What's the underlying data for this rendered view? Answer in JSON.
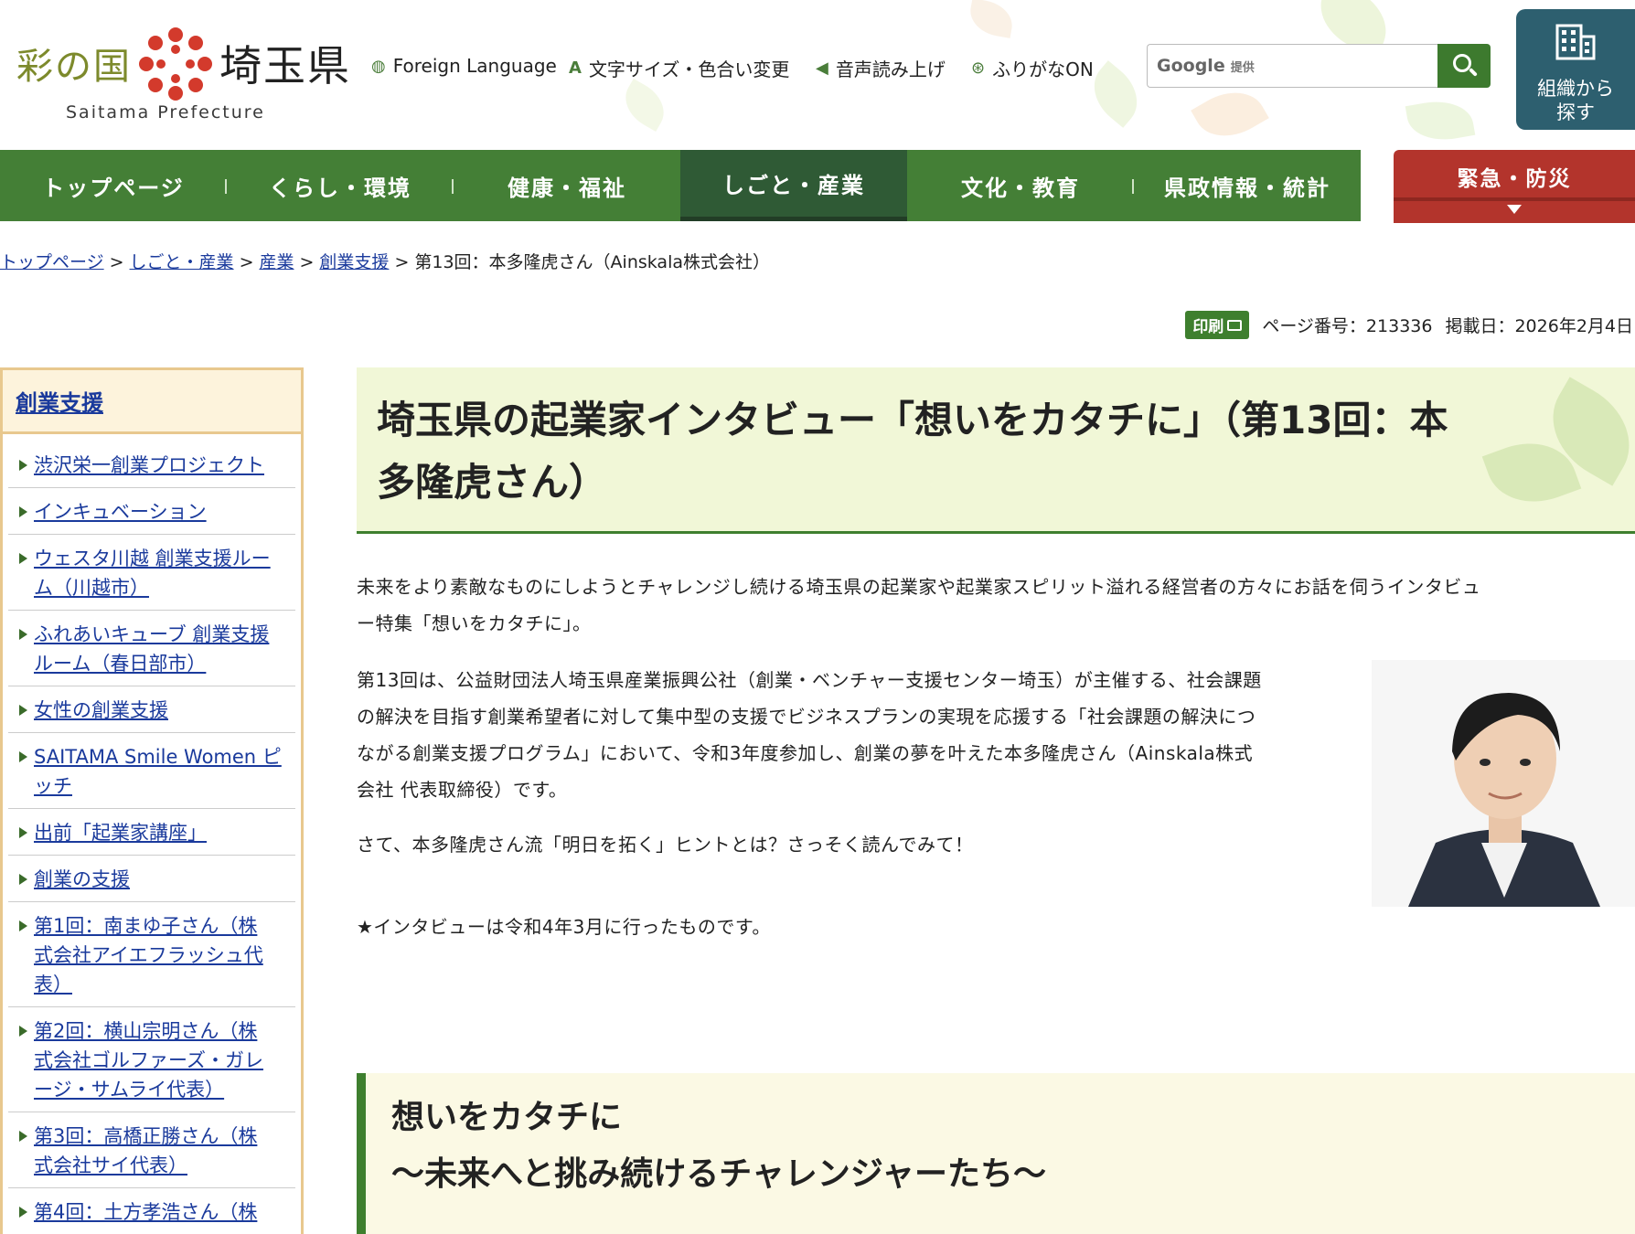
{
  "header": {
    "logo": {
      "irono": "彩の国",
      "pref": "埼玉県",
      "en": "Saitama Prefecture"
    },
    "utility_links": [
      {
        "label": "Foreign Language",
        "icon": "globe-icon"
      },
      {
        "label": "文字サイズ・色合い変更",
        "icon": "text-size-icon"
      },
      {
        "label": "音声読み上げ",
        "icon": "speaker-icon"
      },
      {
        "label": "ふりがなON",
        "icon": "furigana-icon"
      }
    ],
    "search": {
      "brand": "Google",
      "provided": "提供",
      "button_icon": "search-icon"
    },
    "org_button": {
      "line1": "組織から",
      "line2": "探す",
      "icon": "building-icon"
    }
  },
  "nav": {
    "items": [
      {
        "label": "トップページ"
      },
      {
        "label": "くらし・環境"
      },
      {
        "label": "健康・福祉"
      },
      {
        "label": "しごと・産業"
      },
      {
        "label": "文化・教育"
      },
      {
        "label": "県政情報・統計"
      }
    ],
    "active_index": 3,
    "emergency": "緊急・防災"
  },
  "breadcrumb": {
    "links": [
      "トップページ",
      "しごと・産業",
      "産業",
      "創業支援"
    ],
    "current": "第13回：本多隆虎さん（Ainskala株式会社）",
    "separator": ">"
  },
  "meta": {
    "print_label": "印刷",
    "page_number": "ページ番号：213336",
    "posted": "掲載日：2026年2月4日"
  },
  "sidebar": {
    "heading": "創業支援",
    "items": [
      [
        "渋沢栄一創業プロジェクト"
      ],
      [
        "インキュベーション"
      ],
      [
        "ウェスタ川越 創業支援ルー",
        "ム（川越市）"
      ],
      [
        "ふれあいキューブ 創業支援",
        "ルーム（春日部市）"
      ],
      [
        "女性の創業支援"
      ],
      [
        "SAITAMA Smile Women ピ",
        "ッチ"
      ],
      [
        "出前「起業家講座」"
      ],
      [
        "創業の支援"
      ],
      [
        "第1回：南まゆ子さん（株",
        "式会社アイエフラッシュ代",
        "表）"
      ],
      [
        "第2回：横山宗明さん（株",
        "式会社ゴルファーズ・ガレ",
        "ージ・サムライ代表）"
      ],
      [
        "第3回：高橋正勝さん（株",
        "式会社サイ代表）"
      ],
      [
        "第4回：土方孝浩さん（株"
      ]
    ]
  },
  "article": {
    "title_line1": "埼玉県の起業家インタビュー「想いをカタチに」（第13回：本",
    "title_line2": "多隆虎さん）",
    "intro_line1": "未来をより素敵なものにしようとチャレンジし続ける埼玉県の起業家や起業家スピリット溢れる経営者の方々にお話を伺うインタビュ",
    "intro_line2": "ー特集「想いをカタチに」。",
    "body_line1": "第13回は、公益財団法人埼玉県産業振興公社（創業・ベンチャー支援センター埼玉）が主催する、社会課題",
    "body_line2": "の解決を目指す創業希望者に対して集中型の支援でビジネスプランの実現を応援する「社会課題の解決につ",
    "body_line3": "ながる創業支援プログラム」において、令和3年度参加し、創業の夢を叶えた本多隆虎さん（Ainskala株式",
    "body_line4": "会社 代表取締役）です。",
    "lead": "さて、本多隆虎さん流「明日を拓く」ヒントとは？さっそく読んでみて！",
    "note": "★インタビューは令和4年3月に行ったものです。",
    "subheading_line1": "想いをカタチに",
    "subheading_line2": "～未来へと挑み続けるチャレンジャーたち～"
  },
  "colors": {
    "nav_green": "#447f36",
    "nav_active": "#2f5a35",
    "emergency_red": "#b3342c",
    "org_teal": "#2d5f6f",
    "link_blue": "#1a3a9c",
    "sidebar_border": "#e8c88e",
    "title_bg": "#f1f7d7"
  }
}
